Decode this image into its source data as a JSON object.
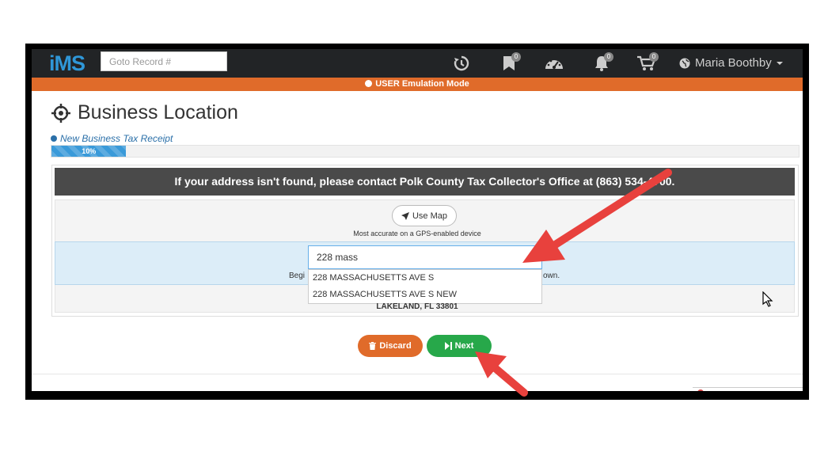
{
  "app": {
    "logo": "iMS"
  },
  "nav": {
    "goto_placeholder": "Goto Record #",
    "badges": {
      "bookmarks": "0",
      "notifications": "0",
      "cart": "0"
    },
    "user_name": "Maria Boothby"
  },
  "emulation_banner": "USER Emulation Mode",
  "page": {
    "title": "Business Location",
    "subtitle": "New Business Tax Receipt",
    "progress_label": "10%",
    "progress_value": 0.1
  },
  "notice": "If your address isn't found, please contact Polk County Tax Collector's Office at (863) 534-4700.",
  "map": {
    "button_label": "Use Map",
    "hint": "Most accurate on a GPS-enabled device"
  },
  "address": {
    "value": "228 mass",
    "hint_left": "Begi",
    "hint_right": "own.",
    "suggestions": [
      "228 MASSACHUSETTS AVE S",
      "228 MASSACHUSETTS AVE S NEW"
    ],
    "city": "LAKELAND, FL 33801"
  },
  "buttons": {
    "discard": "Discard",
    "next": "Next"
  },
  "colors": {
    "accent_orange": "#e06b2a",
    "next_green": "#27a84a",
    "logo_blue": "#2f97d8",
    "arrow_red": "#e8413d"
  }
}
